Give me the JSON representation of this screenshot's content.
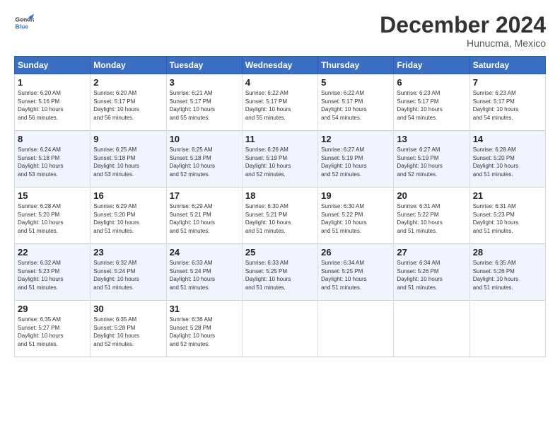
{
  "header": {
    "logo_line1": "General",
    "logo_line2": "Blue",
    "month": "December 2024",
    "location": "Hunucma, Mexico"
  },
  "days_of_week": [
    "Sunday",
    "Monday",
    "Tuesday",
    "Wednesday",
    "Thursday",
    "Friday",
    "Saturday"
  ],
  "weeks": [
    [
      {
        "day": "1",
        "info": "Sunrise: 6:20 AM\nSunset: 5:16 PM\nDaylight: 10 hours\nand 56 minutes."
      },
      {
        "day": "2",
        "info": "Sunrise: 6:20 AM\nSunset: 5:17 PM\nDaylight: 10 hours\nand 56 minutes."
      },
      {
        "day": "3",
        "info": "Sunrise: 6:21 AM\nSunset: 5:17 PM\nDaylight: 10 hours\nand 55 minutes."
      },
      {
        "day": "4",
        "info": "Sunrise: 6:22 AM\nSunset: 5:17 PM\nDaylight: 10 hours\nand 55 minutes."
      },
      {
        "day": "5",
        "info": "Sunrise: 6:22 AM\nSunset: 5:17 PM\nDaylight: 10 hours\nand 54 minutes."
      },
      {
        "day": "6",
        "info": "Sunrise: 6:23 AM\nSunset: 5:17 PM\nDaylight: 10 hours\nand 54 minutes."
      },
      {
        "day": "7",
        "info": "Sunrise: 6:23 AM\nSunset: 5:17 PM\nDaylight: 10 hours\nand 54 minutes."
      }
    ],
    [
      {
        "day": "8",
        "info": "Sunrise: 6:24 AM\nSunset: 5:18 PM\nDaylight: 10 hours\nand 53 minutes."
      },
      {
        "day": "9",
        "info": "Sunrise: 6:25 AM\nSunset: 5:18 PM\nDaylight: 10 hours\nand 53 minutes."
      },
      {
        "day": "10",
        "info": "Sunrise: 6:25 AM\nSunset: 5:18 PM\nDaylight: 10 hours\nand 52 minutes."
      },
      {
        "day": "11",
        "info": "Sunrise: 6:26 AM\nSunset: 5:19 PM\nDaylight: 10 hours\nand 52 minutes."
      },
      {
        "day": "12",
        "info": "Sunrise: 6:27 AM\nSunset: 5:19 PM\nDaylight: 10 hours\nand 52 minutes."
      },
      {
        "day": "13",
        "info": "Sunrise: 6:27 AM\nSunset: 5:19 PM\nDaylight: 10 hours\nand 52 minutes."
      },
      {
        "day": "14",
        "info": "Sunrise: 6:28 AM\nSunset: 5:20 PM\nDaylight: 10 hours\nand 51 minutes."
      }
    ],
    [
      {
        "day": "15",
        "info": "Sunrise: 6:28 AM\nSunset: 5:20 PM\nDaylight: 10 hours\nand 51 minutes."
      },
      {
        "day": "16",
        "info": "Sunrise: 6:29 AM\nSunset: 5:20 PM\nDaylight: 10 hours\nand 51 minutes."
      },
      {
        "day": "17",
        "info": "Sunrise: 6:29 AM\nSunset: 5:21 PM\nDaylight: 10 hours\nand 51 minutes."
      },
      {
        "day": "18",
        "info": "Sunrise: 6:30 AM\nSunset: 5:21 PM\nDaylight: 10 hours\nand 51 minutes."
      },
      {
        "day": "19",
        "info": "Sunrise: 6:30 AM\nSunset: 5:22 PM\nDaylight: 10 hours\nand 51 minutes."
      },
      {
        "day": "20",
        "info": "Sunrise: 6:31 AM\nSunset: 5:22 PM\nDaylight: 10 hours\nand 51 minutes."
      },
      {
        "day": "21",
        "info": "Sunrise: 6:31 AM\nSunset: 5:23 PM\nDaylight: 10 hours\nand 51 minutes."
      }
    ],
    [
      {
        "day": "22",
        "info": "Sunrise: 6:32 AM\nSunset: 5:23 PM\nDaylight: 10 hours\nand 51 minutes."
      },
      {
        "day": "23",
        "info": "Sunrise: 6:32 AM\nSunset: 5:24 PM\nDaylight: 10 hours\nand 51 minutes."
      },
      {
        "day": "24",
        "info": "Sunrise: 6:33 AM\nSunset: 5:24 PM\nDaylight: 10 hours\nand 51 minutes."
      },
      {
        "day": "25",
        "info": "Sunrise: 6:33 AM\nSunset: 5:25 PM\nDaylight: 10 hours\nand 51 minutes."
      },
      {
        "day": "26",
        "info": "Sunrise: 6:34 AM\nSunset: 5:25 PM\nDaylight: 10 hours\nand 51 minutes."
      },
      {
        "day": "27",
        "info": "Sunrise: 6:34 AM\nSunset: 5:26 PM\nDaylight: 10 hours\nand 51 minutes."
      },
      {
        "day": "28",
        "info": "Sunrise: 6:35 AM\nSunset: 5:26 PM\nDaylight: 10 hours\nand 51 minutes."
      }
    ],
    [
      {
        "day": "29",
        "info": "Sunrise: 6:35 AM\nSunset: 5:27 PM\nDaylight: 10 hours\nand 51 minutes."
      },
      {
        "day": "30",
        "info": "Sunrise: 6:35 AM\nSunset: 5:28 PM\nDaylight: 10 hours\nand 52 minutes."
      },
      {
        "day": "31",
        "info": "Sunrise: 6:36 AM\nSunset: 5:28 PM\nDaylight: 10 hours\nand 52 minutes."
      },
      {
        "day": "",
        "info": ""
      },
      {
        "day": "",
        "info": ""
      },
      {
        "day": "",
        "info": ""
      },
      {
        "day": "",
        "info": ""
      }
    ]
  ]
}
